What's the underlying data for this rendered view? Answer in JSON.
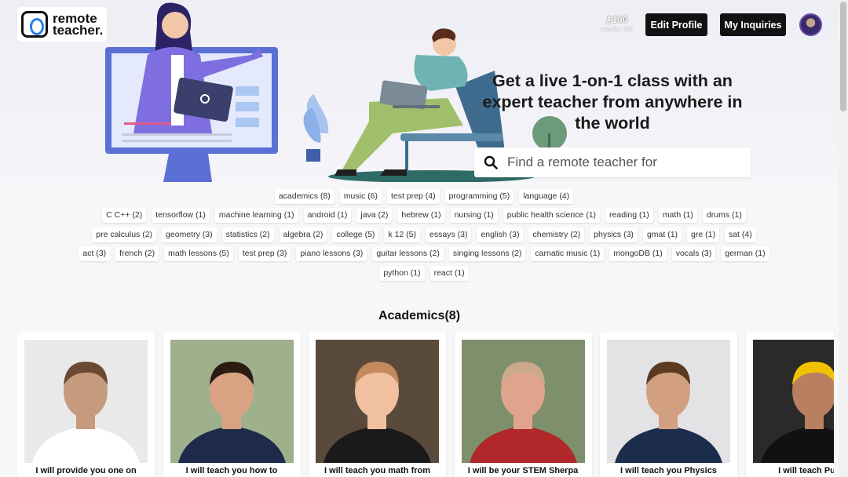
{
  "brand": {
    "line1": "remote",
    "line2": "teacher."
  },
  "header": {
    "credits_count": "100",
    "credits_label": "credits left",
    "edit_profile": "Edit Profile",
    "my_inquiries": "My Inquiries"
  },
  "hero": {
    "title": "Get a live 1-on-1 class with an expert teacher from anywhere in the world",
    "search_placeholder": "Find a remote teacher for"
  },
  "tag_rows": [
    [
      "academics (8)",
      "music (6)",
      "test prep (4)",
      "programming (5)",
      "language (4)"
    ],
    [
      "C C++ (2)",
      "tensorflow (1)",
      "machine learning (1)",
      "android (1)",
      "java (2)",
      "hebrew (1)",
      "nursing (1)",
      "public health science (1)",
      "reading (1)",
      "math (1)",
      "drums (1)"
    ],
    [
      "pre calculus (2)",
      "geometry (3)",
      "statistics (2)",
      "algebra (2)",
      "college (5)",
      "k 12 (5)",
      "essays (3)",
      "english (3)",
      "chemistry (2)",
      "physics (3)",
      "gmat (1)",
      "gre (1)",
      "sat (4)"
    ],
    [
      "act (3)",
      "french (2)",
      "math lessons (5)",
      "test prep (3)",
      "piano lessons (3)",
      "guitar lessons (2)",
      "singing lessons (2)",
      "carnatic music (1)",
      "mongoDB (1)",
      "vocals (3)",
      "german (1)"
    ],
    [
      "python (1)",
      "react (1)"
    ]
  ],
  "section": {
    "title": "Academics(8)"
  },
  "cards": [
    {
      "caption": "I will provide you one on",
      "photo": "teacher-photo-1"
    },
    {
      "caption": "I will teach you how to",
      "photo": "teacher-photo-2"
    },
    {
      "caption": "I will teach you math from",
      "photo": "teacher-photo-3"
    },
    {
      "caption": "I will be your STEM Sherpa",
      "photo": "teacher-photo-4"
    },
    {
      "caption": "I will teach you Physics",
      "photo": "teacher-photo-5"
    },
    {
      "caption": "I will teach Public",
      "photo": "teacher-photo-6"
    }
  ],
  "icons": {
    "search": "search-icon",
    "credits": "key-icon"
  },
  "colors": {
    "dark_button": "#111111",
    "brand_blue": "#2b7de9",
    "hero_bg": "#eeeef5"
  }
}
